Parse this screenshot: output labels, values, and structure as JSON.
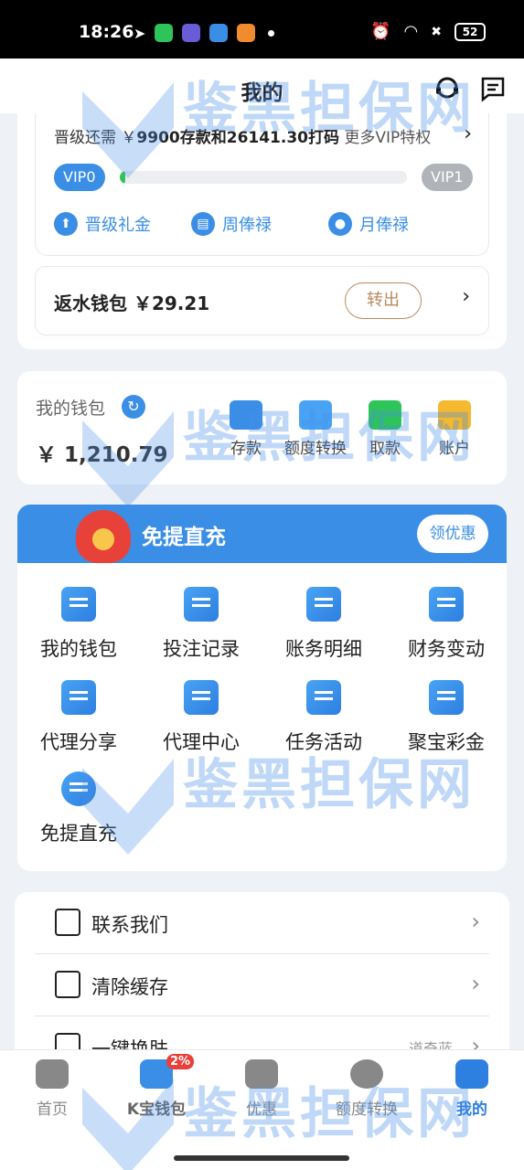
{
  "status_bar": {
    "time": "18:26",
    "battery": "52"
  },
  "header": {
    "title": "我的"
  },
  "vip": {
    "progress_text_prefix": "晋级还需 ￥",
    "deposit_needed": "9900",
    "mid_text": "存款和",
    "bet_needed": "26141.30",
    "bet_suffix": "打码",
    "more_link": "更多VIP特权",
    "current_level": "VIP0",
    "next_level": "VIP1",
    "progress": 0.02,
    "links": [
      "晋级礼金",
      "周俸禄",
      "月俸禄"
    ]
  },
  "rebate": {
    "label": "返水钱包 ￥29.21",
    "button": "转出"
  },
  "wallet": {
    "title": "我的钱包",
    "amount": "￥ 1,210.79",
    "actions": [
      "存款",
      "额度转换",
      "取款",
      "账户"
    ]
  },
  "promo": {
    "title": "免提直充",
    "button": "领优惠",
    "items": [
      "我的钱包",
      "投注记录",
      "账务明细",
      "财务变动",
      "代理分享",
      "代理中心",
      "任务活动",
      "聚宝彩金",
      "免提直充"
    ]
  },
  "settings": {
    "items": [
      {
        "label": "联系我们",
        "value": ""
      },
      {
        "label": "清除缓存",
        "value": ""
      },
      {
        "label": "一键换肤",
        "value": "道奇蓝"
      }
    ]
  },
  "bottom_nav": {
    "items": [
      "首页",
      "K宝钱包",
      "优惠",
      "额度转换",
      "我的"
    ],
    "badge": "2%",
    "active_index": 4
  },
  "watermark": "鉴黑担保网",
  "colors": {
    "accent": "#3a8ee6",
    "green": "#2ec45a",
    "gold": "#b88a5e"
  }
}
